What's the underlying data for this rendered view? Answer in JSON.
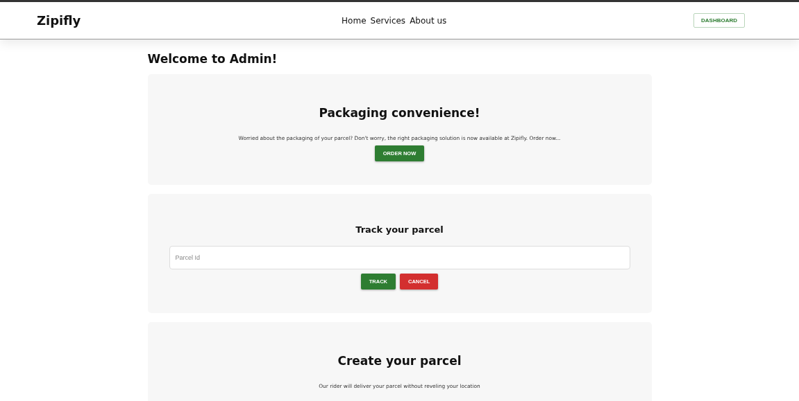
{
  "header": {
    "brand": "Zipifly",
    "nav": [
      {
        "label": "Home"
      },
      {
        "label": "Services"
      },
      {
        "label": "About us"
      }
    ],
    "action": "DASHBOARD"
  },
  "welcome": "Welcome to Admin!",
  "packaging": {
    "title": "Packaging convenience!",
    "text": "Worried about the packaging of your parcel? Don't worry, the right packaging solution is now available at Zipifly. Order now...",
    "button": "ORDER NOW"
  },
  "track": {
    "title": "Track your parcel",
    "field": {
      "placeholder": "Parcel Id"
    },
    "buttons": [
      {
        "label": "TRACK",
        "kind": "primary"
      },
      {
        "label": "CANCEL",
        "kind": "danger"
      }
    ]
  },
  "create": {
    "title": "Create your parcel",
    "text": "Our rider will deliver your parcel without reveling your location"
  }
}
